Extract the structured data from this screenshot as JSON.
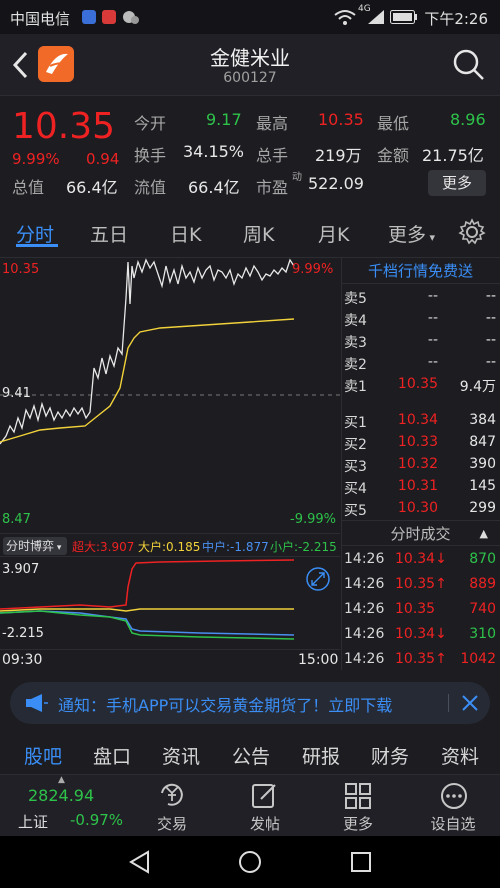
{
  "status": {
    "carrier": "中国电信",
    "network": "4G",
    "time": "下午2:26"
  },
  "header": {
    "name": "金健米业",
    "code": "600127"
  },
  "quote": {
    "price": "10.35",
    "pct": "9.99%",
    "change": "0.94",
    "open_label": "今开",
    "open": "9.17",
    "high_label": "最高",
    "high": "10.35",
    "low_label": "最低",
    "low": "8.96",
    "turnover_label": "换手",
    "turnover": "34.15%",
    "volume_label": "总手",
    "volume": "219万",
    "amount_label": "金额",
    "amount": "21.75亿",
    "mktcap_label": "总值",
    "mktcap": "66.4亿",
    "float_label": "流值",
    "float": "66.4亿",
    "pe_label": "市盈",
    "pe_sup": "动",
    "pe": "522.09",
    "more": "更多"
  },
  "tabs": [
    "分时",
    "五日",
    "日K",
    "周K",
    "月K",
    "更多"
  ],
  "chart": {
    "top_price": "10.35",
    "top_pct": "9.99%",
    "mid_price": "9.41",
    "bottom_price": "8.47",
    "bottom_pct": "-9.99%",
    "indicator_name": "分时博弈",
    "super_label": "超大:",
    "super": "3.907",
    "big_label": "大户:",
    "big": "0.185",
    "mid_label": "中户:",
    "mid": "-1.877",
    "small_label": "小户:",
    "small": "-2.215",
    "ind_top": "3.907",
    "ind_bottom": "-2.215",
    "time_start": "09:30",
    "time_end": "15:00"
  },
  "chart_data": {
    "type": "line",
    "x": [
      "09:30",
      "15:00"
    ],
    "ylim": [
      8.47,
      10.35
    ],
    "reference": 9.41
  },
  "book": {
    "title": "千档行情免费送",
    "sells": [
      {
        "label": "卖5",
        "price": "--",
        "vol": "--"
      },
      {
        "label": "卖4",
        "price": "--",
        "vol": "--"
      },
      {
        "label": "卖3",
        "price": "--",
        "vol": "--"
      },
      {
        "label": "卖2",
        "price": "--",
        "vol": "--"
      },
      {
        "label": "卖1",
        "price": "10.35",
        "vol": "9.4万"
      }
    ],
    "buys": [
      {
        "label": "买1",
        "price": "10.34",
        "vol": "384"
      },
      {
        "label": "买2",
        "price": "10.33",
        "vol": "847"
      },
      {
        "label": "买3",
        "price": "10.32",
        "vol": "390"
      },
      {
        "label": "买4",
        "price": "10.31",
        "vol": "145"
      },
      {
        "label": "买5",
        "price": "10.30",
        "vol": "299"
      }
    ]
  },
  "trades": {
    "title": "分时成交",
    "rows": [
      {
        "time": "14:26",
        "price": "10.34↓",
        "vol": "870",
        "dir": "down"
      },
      {
        "time": "14:26",
        "price": "10.35↑",
        "vol": "889",
        "dir": "up"
      },
      {
        "time": "14:26",
        "price": "10.35",
        "vol": "740",
        "dir": "up"
      },
      {
        "time": "14:26",
        "price": "10.34↓",
        "vol": "310",
        "dir": "down"
      },
      {
        "time": "14:26",
        "price": "10.35↑",
        "vol": "1042",
        "dir": "up"
      }
    ]
  },
  "notice": {
    "text": "通知：手机APP可以交易黄金期货了！立即下载"
  },
  "subtabs": [
    "股吧",
    "盘口",
    "资讯",
    "公告",
    "研报",
    "财务",
    "资料"
  ],
  "index": {
    "value": "2824.94",
    "name": "上证",
    "pct": "-0.97%"
  },
  "nav": [
    "交易",
    "发帖",
    "更多",
    "设自选"
  ],
  "colors": {
    "up": "#ee2222",
    "down": "#2ec24a",
    "accent": "#3a8ef5",
    "avg": "#f2d23a"
  }
}
